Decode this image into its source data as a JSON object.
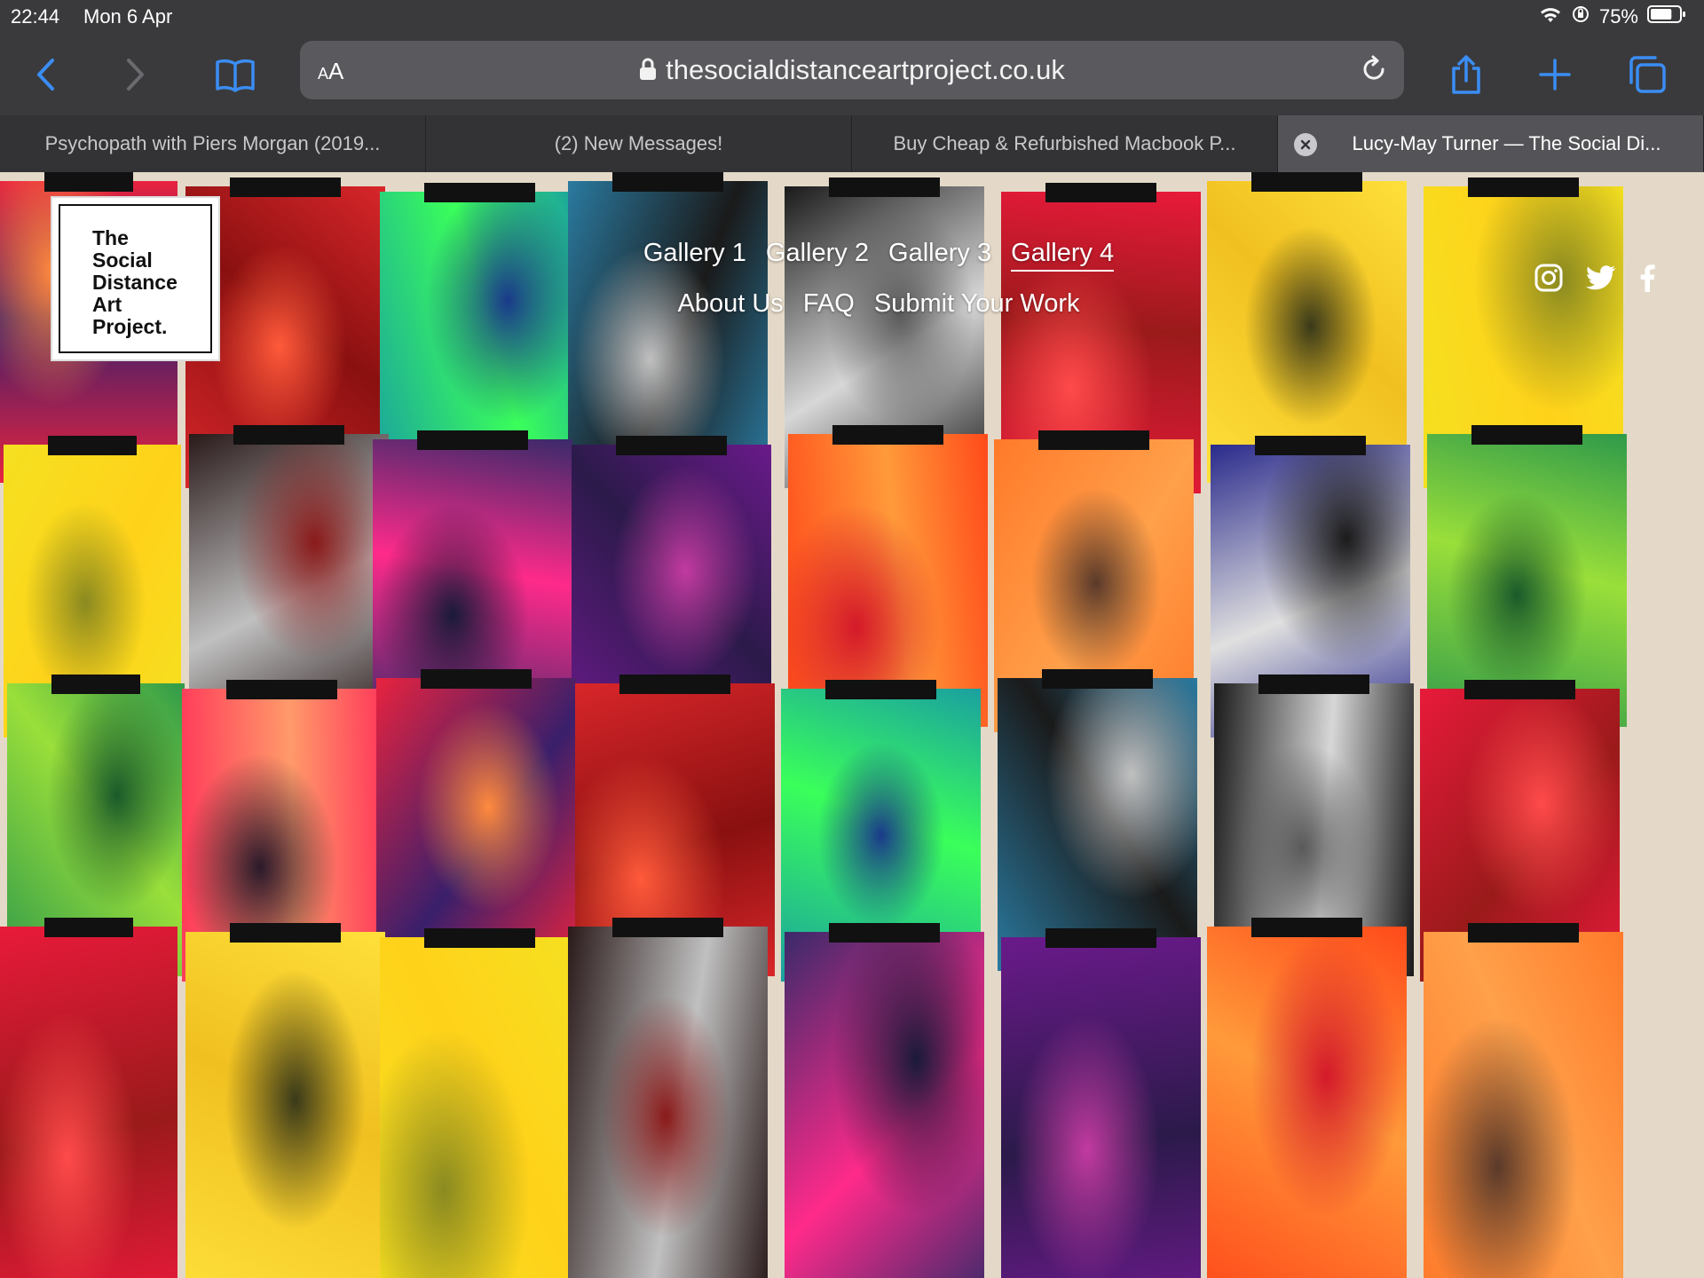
{
  "status": {
    "time": "22:44",
    "date": "Mon 6 Apr",
    "battery": "75%",
    "battery_level": 0.75
  },
  "browser": {
    "aa_label": "AA",
    "url": "thesocialdistanceartproject.co.uk",
    "tabs": [
      {
        "title": "Psychopath with Piers Morgan (2019..."
      },
      {
        "title": "(2) New Messages!"
      },
      {
        "title": "Buy Cheap & Refurbished Macbook P..."
      },
      {
        "title": "Lucy-May Turner — The Social Di..."
      }
    ],
    "active_tab_index": 3
  },
  "site": {
    "logo_lines": [
      "The",
      "Social",
      "Distance",
      "Art",
      "Project."
    ],
    "nav_row1": [
      "Gallery 1",
      "Gallery 2",
      "Gallery 3",
      "Gallery 4"
    ],
    "nav_row2": [
      "About Us",
      "FAQ",
      "Submit Your Work"
    ],
    "current_nav": "Gallery 4",
    "social_icons": [
      "instagram-icon",
      "twitter-icon",
      "facebook-icon"
    ]
  },
  "colors": {
    "accent": "#3b8df4",
    "chrome": "#3a3a3c",
    "wall": "#e4d9c8"
  }
}
